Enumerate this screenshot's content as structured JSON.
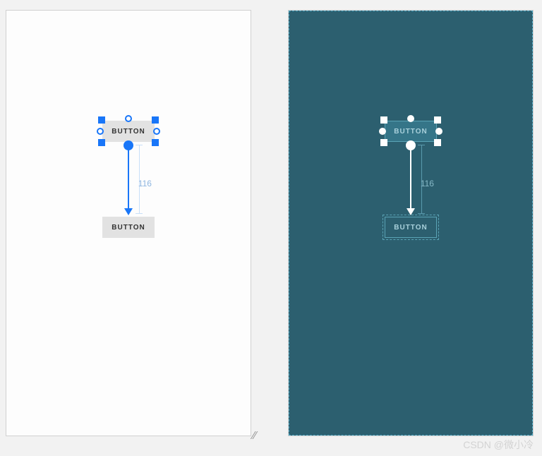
{
  "constraint_distance": "116",
  "button_label": "BUTTON",
  "watermark": "CSDN @微小冷",
  "colors": {
    "accent_light": "#1976f8",
    "accent_dark": "#ffffff",
    "bg_light": "#fdfdfd",
    "bg_dark": "#2c5f6f"
  }
}
